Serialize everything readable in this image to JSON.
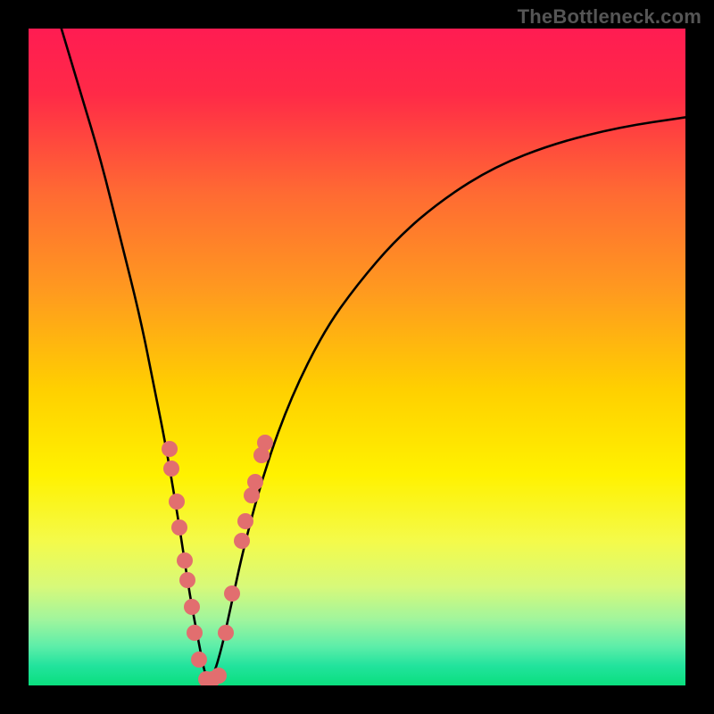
{
  "watermark": "TheBottleneck.com",
  "colors": {
    "gradient_stops": [
      {
        "offset": 0.0,
        "color": "#ff1c52"
      },
      {
        "offset": 0.1,
        "color": "#ff2a47"
      },
      {
        "offset": 0.25,
        "color": "#ff6a33"
      },
      {
        "offset": 0.4,
        "color": "#ff9a1f"
      },
      {
        "offset": 0.55,
        "color": "#ffd000"
      },
      {
        "offset": 0.68,
        "color": "#fff200"
      },
      {
        "offset": 0.78,
        "color": "#f4fa4a"
      },
      {
        "offset": 0.85,
        "color": "#d7f97a"
      },
      {
        "offset": 0.9,
        "color": "#a0f59d"
      },
      {
        "offset": 0.94,
        "color": "#5eeea9"
      },
      {
        "offset": 0.97,
        "color": "#22e39d"
      },
      {
        "offset": 1.0,
        "color": "#0adf7e"
      }
    ],
    "curve_color": "#000000",
    "dot_color": "#e26e6f",
    "background": "#000000",
    "watermark_color": "#555555"
  },
  "chart_data": {
    "type": "line",
    "title": "",
    "xlabel": "",
    "ylabel": "",
    "xlim": [
      0,
      100
    ],
    "ylim": [
      0,
      100
    ],
    "note": "Single V-shaped bottleneck curve; y=0 is the green optimum band, y=100 is top (maximum mismatch). Left arm falls from top-left down to the trough near x≈27; right arm rises and levels off toward top-right. Pink dots mark sampled points along lower arms.",
    "series": [
      {
        "name": "bottleneck-curve",
        "x": [
          5,
          8,
          11,
          14,
          17,
          19,
          21,
          23,
          24.5,
          26,
          27,
          28,
          29.5,
          31,
          33,
          36,
          40,
          45,
          50,
          56,
          63,
          71,
          80,
          90,
          100
        ],
        "y": [
          100,
          90,
          80,
          68,
          56,
          46,
          36,
          24,
          14,
          6,
          1,
          1,
          6,
          13,
          22,
          33,
          44,
          54,
          61,
          68,
          74,
          79,
          82.5,
          85,
          86.5
        ]
      }
    ],
    "dots": [
      {
        "x": 21.5,
        "y": 36
      },
      {
        "x": 21.8,
        "y": 33
      },
      {
        "x": 22.5,
        "y": 28
      },
      {
        "x": 23.0,
        "y": 24
      },
      {
        "x": 23.8,
        "y": 19
      },
      {
        "x": 24.2,
        "y": 16
      },
      {
        "x": 24.8,
        "y": 12
      },
      {
        "x": 25.3,
        "y": 8
      },
      {
        "x": 26.0,
        "y": 4
      },
      {
        "x": 27.0,
        "y": 1
      },
      {
        "x": 28.0,
        "y": 1
      },
      {
        "x": 29.0,
        "y": 1.5
      },
      {
        "x": 30.0,
        "y": 8
      },
      {
        "x": 31.0,
        "y": 14
      },
      {
        "x": 32.5,
        "y": 22
      },
      {
        "x": 33.0,
        "y": 25
      },
      {
        "x": 34.0,
        "y": 29
      },
      {
        "x": 34.5,
        "y": 31
      },
      {
        "x": 35.5,
        "y": 35
      },
      {
        "x": 36.0,
        "y": 37
      }
    ]
  }
}
